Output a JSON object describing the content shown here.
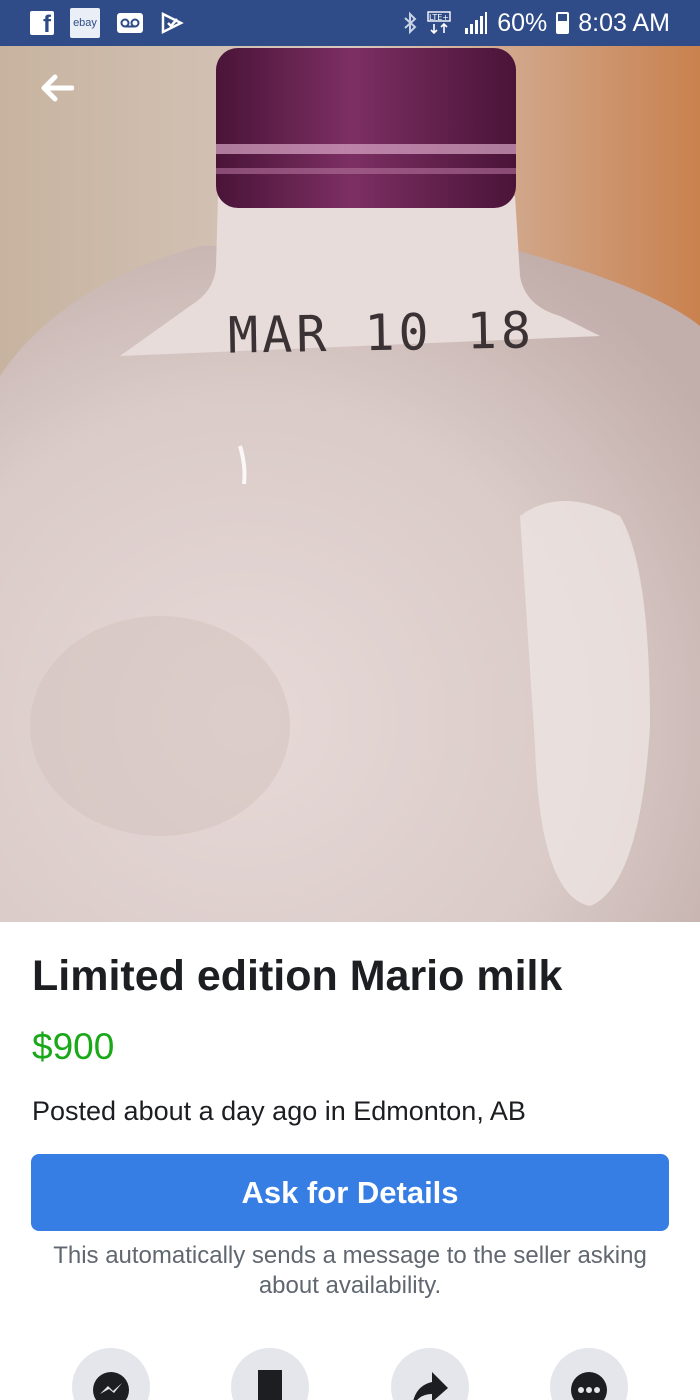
{
  "status_bar": {
    "battery": "60%",
    "time": "8:03 AM",
    "network": "LTE+",
    "notification_icons": [
      "facebook-icon",
      "ebay-icon",
      "voicemail-icon",
      "checklist-icon"
    ],
    "ebay_label": "ebay"
  },
  "photo": {
    "date_stamp": "MAR 10 18"
  },
  "listing": {
    "title": "Limited edition Mario milk",
    "price": "$900",
    "posted": "Posted about a day ago in Edmonton, AB"
  },
  "ask_button": {
    "label": "Ask for Details",
    "note": "This automatically sends a message to the seller asking about availability."
  },
  "actions": [
    "messenger-icon",
    "save-icon",
    "share-icon",
    "more-icon"
  ],
  "colors": {
    "status_bar": "#2f4c88",
    "price": "#18a818",
    "primary_button": "#377ee4",
    "action_circle": "#e4e6eb"
  }
}
